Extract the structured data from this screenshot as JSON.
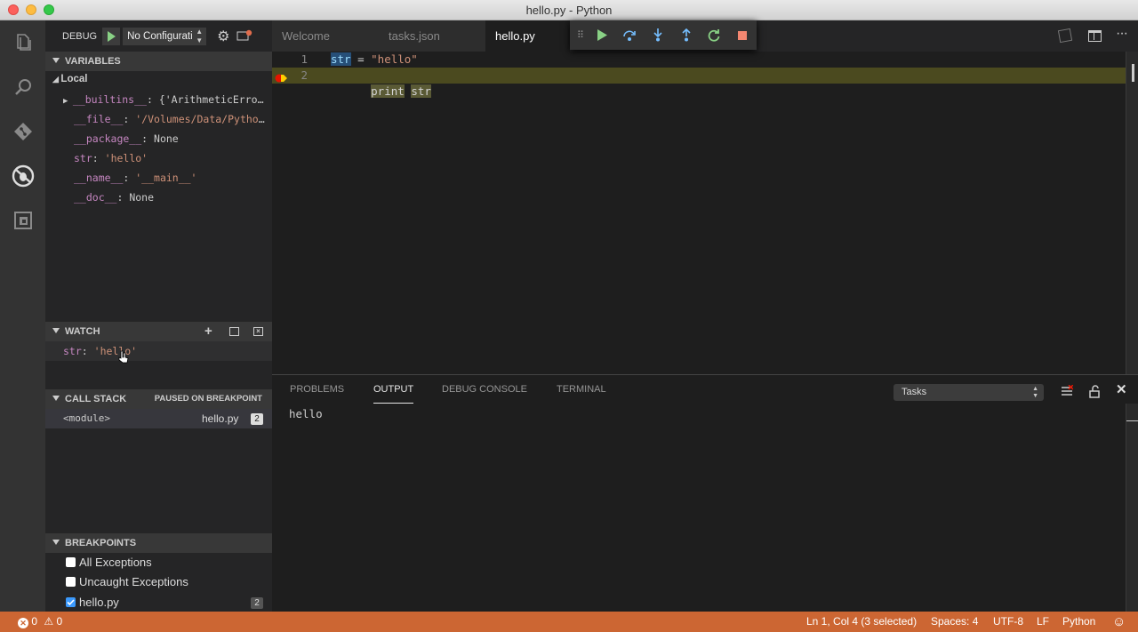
{
  "window": {
    "title": "hello.py - Python"
  },
  "colors": {
    "statusbar": "#cc6633",
    "breakpoint": "#e51400",
    "highlight_line": "#4b4a1f"
  },
  "debug": {
    "label": "DEBUG",
    "config": "No Configurati",
    "sections": {
      "variables": "VARIABLES",
      "local": "Local",
      "watch": "WATCH",
      "call_stack": "CALL STACK",
      "paused": "PAUSED ON BREAKPOINT",
      "breakpoints": "BREAKPOINTS"
    },
    "variables": [
      {
        "name": "__builtins__",
        "sep": ": ",
        "value": "{'ArithmeticError'…",
        "kind": "plain",
        "expandable": true
      },
      {
        "name": "__file__",
        "sep": ": ",
        "value": "'/Volumes/Data/Python/…",
        "kind": "str"
      },
      {
        "name": "__package__",
        "sep": ": ",
        "value": "None",
        "kind": "plain"
      },
      {
        "name": "str",
        "sep": ": ",
        "value": "'hello'",
        "kind": "str"
      },
      {
        "name": "__name__",
        "sep": ": ",
        "value": "'__main__'",
        "kind": "str"
      },
      {
        "name": "__doc__",
        "sep": ": ",
        "value": "None",
        "kind": "plain"
      }
    ],
    "watch": [
      {
        "name": "str",
        "sep": ": ",
        "value": "'hello'"
      }
    ],
    "call_stack": [
      {
        "frame": "<module>",
        "file": "hello.py",
        "line": "2"
      }
    ],
    "breakpoints": [
      {
        "label": "All Exceptions",
        "checked": false
      },
      {
        "label": "Uncaught Exceptions",
        "checked": false
      },
      {
        "label": "hello.py",
        "checked": true,
        "count": "2"
      }
    ]
  },
  "editor": {
    "tabs": [
      {
        "label": "Welcome",
        "active": false
      },
      {
        "label": "tasks.json",
        "active": false
      },
      {
        "label": "hello.py",
        "active": true
      }
    ],
    "lines": [
      {
        "num": "1",
        "tok1": "str",
        "tok2": " = ",
        "tok3": "\"hello\""
      },
      {
        "num": "2",
        "tok1": "print",
        "tok2": " ",
        "tok3": "str"
      }
    ]
  },
  "panel": {
    "tabs": [
      "PROBLEMS",
      "OUTPUT",
      "DEBUG CONSOLE",
      "TERMINAL"
    ],
    "active_tab": "OUTPUT",
    "dropdown": "Tasks",
    "output": "hello"
  },
  "status": {
    "errors": "0",
    "warnings": "0",
    "position": "Ln 1, Col 4 (3 selected)",
    "spaces": "Spaces: 4",
    "encoding": "UTF-8",
    "eol": "LF",
    "language": "Python"
  }
}
